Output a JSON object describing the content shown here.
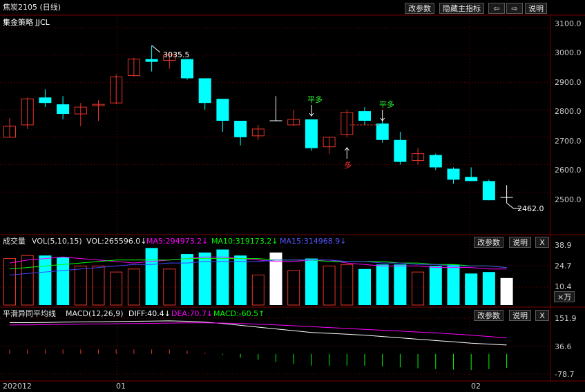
{
  "title": "焦炭2105 (日线)",
  "strategy": "集金策略 JJCL",
  "toolbar": {
    "params": "改参数",
    "hide_main": "隐藏主指标",
    "prev": "⇦",
    "next": "⇨",
    "help": "说明"
  },
  "panel_buttons": {
    "params": "改参数",
    "help": "说明",
    "close": "X"
  },
  "colors": {
    "up": "#e8352a",
    "down": "#00ffff",
    "white": "#ffffff",
    "ma5": "#ff00ff",
    "ma10": "#00ff00",
    "ma15": "#4444ff",
    "grid": "#7a0000",
    "buy": "#ff3030",
    "flat": "#30ff30"
  },
  "price_axis": [
    "3100.0",
    "3000.0",
    "2900.0",
    "2800.0",
    "2700.0",
    "2600.0",
    "2500.0"
  ],
  "annotations": {
    "high": "3035.5",
    "low": "2462.0",
    "flat1": "平多",
    "flat2": "平多",
    "buy": "多"
  },
  "vol": {
    "name": "成交量",
    "params": "VOL(5,10,15)",
    "vol": "VOL:265596.0↓",
    "ma5": "MA5:294973.2↓",
    "ma10": "MA10:319173.2↓",
    "ma15": "MA15:314968.9↓",
    "axis": [
      "38.9",
      "24.7",
      "10.4"
    ],
    "unit": "×万"
  },
  "macd": {
    "name": "平滑异同平均线",
    "params": "MACD(12,26,9)",
    "diff": "DIFF:40.4↓",
    "dea": "DEA:70.7↓",
    "macd": "MACD:-60.5↑",
    "axis": [
      "151.9",
      "36.6",
      "-78.7"
    ]
  },
  "dates": [
    "202012",
    "01",
    "02"
  ],
  "chart_data": {
    "type": "candlestick",
    "ylim": [
      2420,
      3110
    ],
    "candles": [
      {
        "o": 2700,
        "h": 2770,
        "l": 2700,
        "c": 2740,
        "v": 31
      },
      {
        "o": 2745,
        "h": 2845,
        "l": 2730,
        "c": 2840,
        "v": 33
      },
      {
        "o": 2845,
        "h": 2875,
        "l": 2810,
        "c": 2825,
        "v": 33
      },
      {
        "o": 2820,
        "h": 2850,
        "l": 2765,
        "c": 2785,
        "v": 32
      },
      {
        "o": 2785,
        "h": 2825,
        "l": 2740,
        "c": 2810,
        "v": 26
      },
      {
        "o": 2815,
        "h": 2835,
        "l": 2760,
        "c": 2820,
        "v": 26
      },
      {
        "o": 2825,
        "h": 2930,
        "l": 2820,
        "c": 2920,
        "v": 22
      },
      {
        "o": 2925,
        "h": 2990,
        "l": 2920,
        "c": 2985,
        "v": 24
      },
      {
        "o": 2985,
        "h": 3035,
        "l": 2940,
        "c": 2975,
        "v": 38
      },
      {
        "o": 2980,
        "h": 3010,
        "l": 2950,
        "c": 3000,
        "v": 24
      },
      {
        "o": 2985,
        "h": 2985,
        "l": 2910,
        "c": 2915,
        "v": 34
      },
      {
        "o": 2915,
        "h": 2915,
        "l": 2800,
        "c": 2825,
        "v": 35
      },
      {
        "o": 2840,
        "h": 2840,
        "l": 2720,
        "c": 2760,
        "v": 37
      },
      {
        "o": 2760,
        "h": 2760,
        "l": 2670,
        "c": 2700,
        "v": 33
      },
      {
        "o": 2705,
        "h": 2745,
        "l": 2690,
        "c": 2730,
        "v": 20
      },
      {
        "o": 2760,
        "h": 2850,
        "l": 2760,
        "c": 2760,
        "v": 35
      },
      {
        "o": 2745,
        "h": 2800,
        "l": 2740,
        "c": 2765,
        "v": 23
      },
      {
        "o": 2765,
        "h": 2765,
        "l": 2650,
        "c": 2660,
        "v": 31
      },
      {
        "o": 2665,
        "h": 2700,
        "l": 2640,
        "c": 2700,
        "v": 26
      },
      {
        "o": 2710,
        "h": 2800,
        "l": 2700,
        "c": 2790,
        "v": 27
      },
      {
        "o": 2795,
        "h": 2810,
        "l": 2745,
        "c": 2760,
        "v": 24
      },
      {
        "o": 2750,
        "h": 2760,
        "l": 2680,
        "c": 2690,
        "v": 27
      },
      {
        "o": 2690,
        "h": 2720,
        "l": 2600,
        "c": 2610,
        "v": 27
      },
      {
        "o": 2615,
        "h": 2660,
        "l": 2600,
        "c": 2640,
        "v": 22
      },
      {
        "o": 2635,
        "h": 2640,
        "l": 2580,
        "c": 2590,
        "v": 26
      },
      {
        "o": 2585,
        "h": 2590,
        "l": 2530,
        "c": 2545,
        "v": 27
      },
      {
        "o": 2555,
        "h": 2590,
        "l": 2540,
        "c": 2540,
        "v": 21
      },
      {
        "o": 2540,
        "h": 2545,
        "l": 2470,
        "c": 2470,
        "v": 22
      },
      {
        "o": 2480,
        "h": 2525,
        "l": 2460,
        "c": 2480,
        "v": 18
      }
    ],
    "vol_ylim": [
      0,
      40
    ],
    "ma5": [
      28,
      30,
      31,
      32,
      31,
      30,
      29,
      28,
      29,
      30,
      31,
      32,
      32,
      31,
      30,
      29,
      29,
      30,
      30,
      28,
      27,
      26,
      26,
      26,
      25,
      25,
      25,
      24,
      24
    ],
    "ma10": [
      24,
      25,
      26,
      27,
      28,
      29,
      30,
      30,
      30,
      30,
      31,
      31,
      31,
      31,
      31,
      30,
      30,
      30,
      29,
      29,
      29,
      29,
      28,
      28,
      27,
      27,
      26,
      26,
      25
    ],
    "ma15": [
      20,
      21,
      22,
      23,
      24,
      25,
      26,
      27,
      27,
      28,
      28,
      29,
      29,
      29,
      29,
      30,
      30,
      30,
      30,
      29,
      29,
      28,
      28,
      27,
      27,
      26,
      26,
      26,
      25
    ],
    "macd_ylim": [
      -90,
      160
    ],
    "diff": [
      140,
      140,
      141,
      142,
      143,
      144,
      145,
      146,
      147,
      148,
      146,
      142,
      136,
      128,
      120,
      112,
      104,
      96,
      92,
      88,
      84,
      78,
      72,
      66,
      60,
      54,
      48,
      44,
      40
    ],
    "dea": [
      130,
      130,
      131,
      132,
      133,
      134,
      135,
      136,
      137,
      138,
      139,
      139,
      138,
      136,
      133,
      130,
      126,
      122,
      118,
      114,
      110,
      106,
      102,
      98,
      94,
      89,
      84,
      78,
      71
    ],
    "hist": [
      20,
      20,
      20,
      20,
      20,
      20,
      20,
      20,
      20,
      20,
      14,
      6,
      -4,
      -16,
      -26,
      -36,
      -44,
      -52,
      -52,
      -52,
      -52,
      -56,
      -60,
      -64,
      -68,
      -70,
      -72,
      -68,
      -62
    ]
  }
}
